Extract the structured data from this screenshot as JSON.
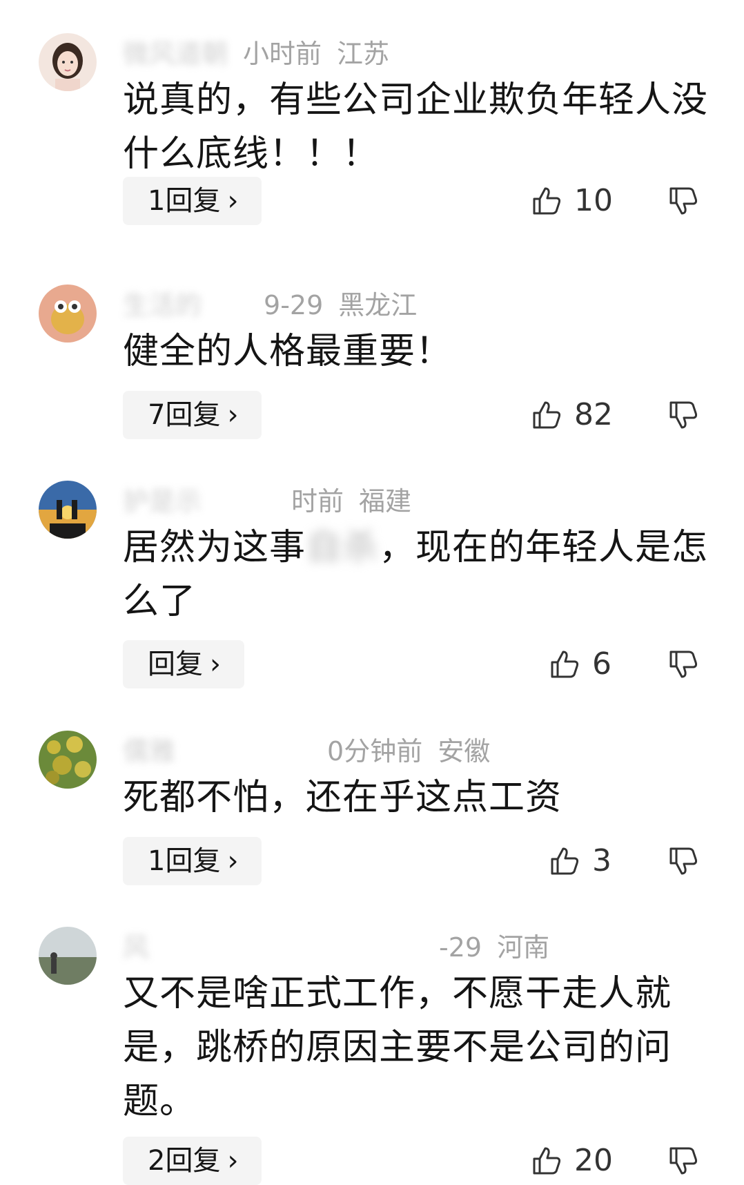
{
  "comments": [
    {
      "name": "微风道朝",
      "time": "小时前",
      "location": "江苏",
      "text": "说真的，有些公司企业欺负年轻人没什么底线！！！",
      "reply_label": "1回复",
      "likes": "10"
    },
    {
      "name": "生活的",
      "time": "9-29",
      "location": "黑龙江",
      "text": "健全的人格最重要！",
      "reply_label": "7回复",
      "likes": "82"
    },
    {
      "name": "护是示",
      "time": "时前",
      "location": "福建",
      "text_before": "居然为这事",
      "text_after": "，现在的年轻人是怎么了",
      "reply_label": "回复",
      "likes": "6"
    },
    {
      "name": "儒雅",
      "time": "0分钟前",
      "location": "安徽",
      "text": "死都不怕，还在乎这点工资",
      "reply_label": "1回复",
      "likes": "3"
    },
    {
      "name": "风",
      "time": "-29",
      "location": "河南",
      "text": "又不是啥正式工作，不愿干走人就是，跳桥的原因主要不是公司的问题。",
      "reply_label": "2回复",
      "likes": "20"
    }
  ],
  "icons": {
    "reply_chevron": "chevron-right-icon",
    "like": "thumbs-up-icon",
    "dislike": "thumbs-down-icon"
  },
  "colors": {
    "meta_text": "#a3a3a3",
    "reply_bg": "#f4f4f4",
    "body_text": "#151515"
  }
}
